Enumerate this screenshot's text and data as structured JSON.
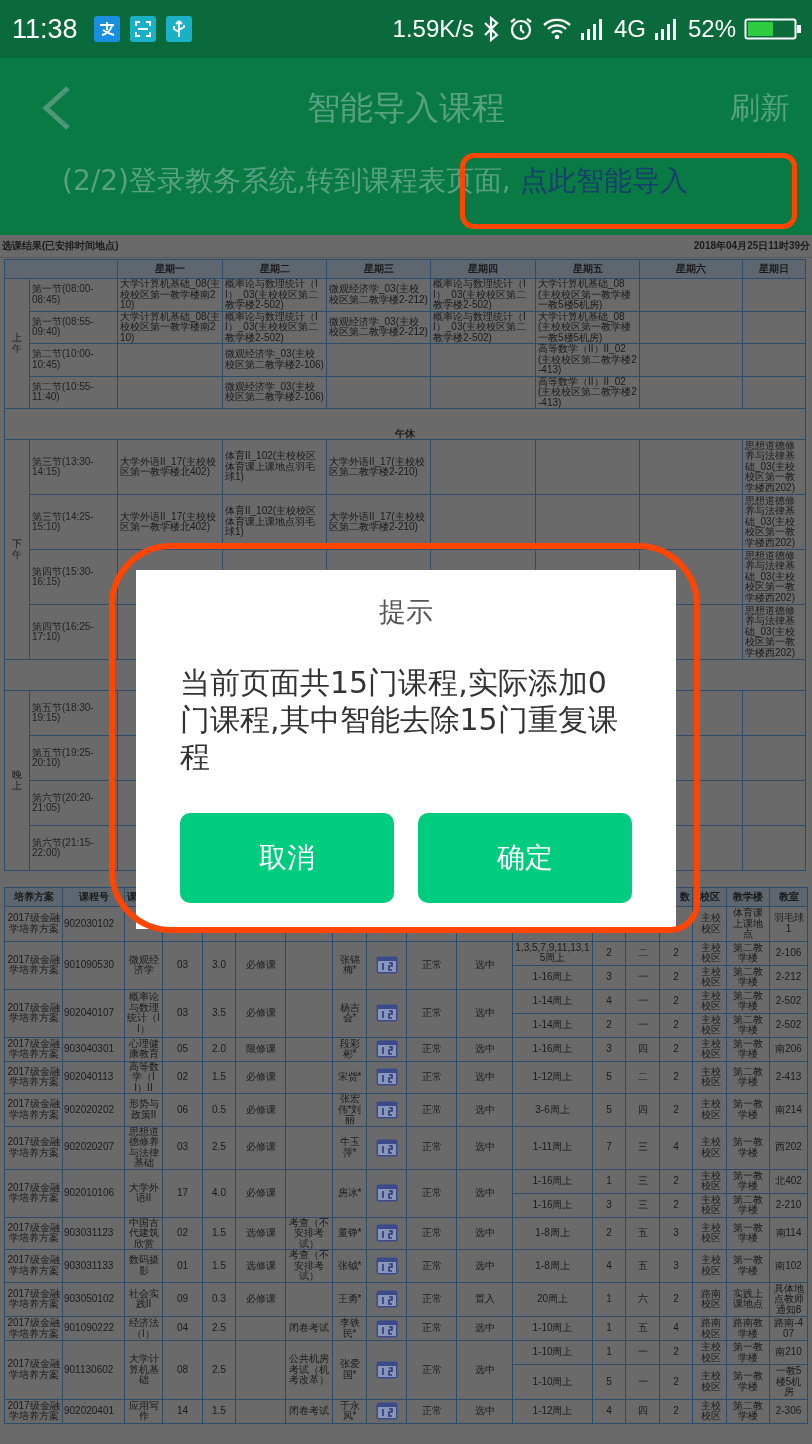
{
  "status_bar": {
    "time": "11:38",
    "speed": "1.59K/s",
    "network": "4G",
    "battery": "52%"
  },
  "app_bar": {
    "title": "智能导入课程",
    "action": "刷新",
    "instruction": "(2/2)登录教务系统,转到课程表页面, ",
    "link": "点此智能导入"
  },
  "timetable": {
    "caption": "选课结果(已安排时间地点)",
    "timestamp": "2018年04月25日11时39分",
    "days": [
      "星期一",
      "星期二",
      "星期三",
      "星期四",
      "星期五",
      "星期六",
      "星期日"
    ],
    "sections": [
      {
        "kind": "group",
        "label": "上午",
        "periods": [
          {
            "name": "第一节(08:00-08:45)",
            "cells": [
              "大学计算机基础_08(主校校区第一教学楼南210)",
              "概率论与数理统计（II）_03(主校校区第二教学楼2-502)",
              "微观经济学_03(主校校区第二教学楼2-212)",
              "概率论与数理统计（II）_03(主校校区第二教学楼2-502)",
              "大学计算机基础_08(主校校区第一教学楼一教5楼5机房)",
              null,
              null
            ]
          },
          {
            "name": "第一节(08:55-09:40)",
            "cells": [
              "大学计算机基础_08(主校校区第一教学楼南210)",
              "概率论与数理统计（II）_03(主校校区第二教学楼2-502)",
              "微观经济学_03(主校校区第二教学楼2-212)",
              "概率论与数理统计（II）_03(主校校区第二教学楼2-502)",
              "大学计算机基础_08(主校校区第一教学楼一教5楼5机房)",
              null,
              null
            ]
          },
          {
            "name": "第二节(10:00-10:45)",
            "cells": [
              null,
              "微观经济学_03(主校校区第二教学楼2-106)",
              null,
              null,
              "高等数学（II）II_02(主校校区第二教学楼2-413)",
              null,
              null
            ]
          },
          {
            "name": "第二节(10:55-11:40)",
            "cells": [
              null,
              "微观经济学_03(主校校区第二教学楼2-106)",
              null,
              null,
              "高等数学（II）II_02(主校校区第二教学楼2-413)",
              null,
              null
            ]
          }
        ]
      },
      {
        "kind": "break",
        "label": "午休"
      },
      {
        "kind": "group",
        "label": "下午",
        "periods": [
          {
            "name": "第三节(13:30-14:15)",
            "cells": [
              "大学外语II_17(主校校区第一教学楼北402)",
              "体育II_102(主校校区体育课上课地点羽毛球1)",
              "大学外语II_17(主校校区第二教学楼2-210)",
              null,
              null,
              null,
              "思想道德修养与法律基础_03(主校校区第一教学楼西202)"
            ]
          },
          {
            "name": "第三节(14:25-15:10)",
            "cells": [
              "大学外语II_17(主校校区第一教学楼北402)",
              "体育II_102(主校校区体育课上课地点羽毛球1)",
              "大学外语II_17(主校校区第二教学楼2-210)",
              null,
              null,
              null,
              "思想道德修养与法律基础_03(主校校区第一教学楼西202)"
            ]
          },
          {
            "name": "第四节(15:30-16:15)",
            "cells": [
              null,
              null,
              null,
              null,
              null,
              null,
              "思想道德修养与法律基础_03(主校校区第一教学楼西202)"
            ]
          },
          {
            "name": "第四节(16:25-17:10)",
            "cells": [
              null,
              null,
              null,
              null,
              null,
              null,
              "思想道德修养与法律基础_03(主校校区第一教学楼西202)"
            ]
          }
        ]
      },
      {
        "kind": "break"
      },
      {
        "kind": "group",
        "label": "晚上",
        "periods": [
          {
            "name": "第五节(18:30-19:15)",
            "cells": [
              null,
              null,
              null,
              null,
              null,
              null,
              null
            ]
          },
          {
            "name": "第五节(19:25-20:10)",
            "cells": [
              null,
              null,
              null,
              null,
              null,
              null,
              null
            ]
          },
          {
            "name": "第六节(20:20-21:05)",
            "cells": [
              null,
              null,
              null,
              null,
              null,
              null,
              null
            ]
          },
          {
            "name": "第六节(21:15-22:00)",
            "cells": [
              null,
              null,
              null,
              null,
              null,
              null,
              null
            ]
          }
        ]
      }
    ]
  },
  "course_table": {
    "columns": [
      "培养方案",
      "课程号",
      "课",
      null,
      null,
      null,
      null,
      null,
      null,
      null,
      null,
      null,
      null,
      null,
      "数",
      "校区",
      "教学楼",
      "教室"
    ],
    "rows": [
      {
        "plan": "2017级金融学培养方案",
        "code": "902030102",
        "sessions": [
          {
            "campus": "主校校区",
            "building": "体育课上课地点",
            "room": "羽毛球1"
          }
        ]
      },
      {
        "plan": "2017级金融学培养方案",
        "code": "901090530",
        "name": "微观经济学",
        "seq": "03",
        "credit": "3.0",
        "attr": "必修课",
        "teacher": "张锦梅*",
        "status": "正常",
        "pick": "选中",
        "sessions": [
          {
            "weeks": "1,3,5,7,9,11,13,15周上",
            "period": "2",
            "day": "二",
            "count": "2",
            "campus": "主校校区",
            "building": "第二教学楼",
            "room": "2-106"
          },
          {
            "weeks": "1-16周上",
            "period": "3",
            "day": "一",
            "count": "2",
            "campus": "主校校区",
            "building": "第二教学楼",
            "room": "2-212"
          }
        ]
      },
      {
        "plan": "2017级金融学培养方案",
        "code": "902040107",
        "name": "概率论与数理统计（II）",
        "seq": "03",
        "credit": "3.5",
        "attr": "必修课",
        "teacher": "杨吉会*",
        "status": "正常",
        "pick": "选中",
        "sessions": [
          {
            "weeks": "1-14周上",
            "period": "4",
            "day": "一",
            "count": "2",
            "campus": "主校校区",
            "building": "第二教学楼",
            "room": "2-502"
          },
          {
            "weeks": "1-14周上",
            "period": "2",
            "day": "一",
            "count": "2",
            "campus": "主校校区",
            "building": "第二教学楼",
            "room": "2-502"
          }
        ]
      },
      {
        "plan": "2017级金融学培养方案",
        "code": "903040301",
        "name": "心理健康教育",
        "seq": "05",
        "credit": "2.0",
        "attr": "限修课",
        "teacher": "段彩彬*",
        "status": "正常",
        "pick": "选中",
        "sessions": [
          {
            "weeks": "1-16周上",
            "period": "3",
            "day": "四",
            "count": "2",
            "campus": "主校校区",
            "building": "第一教学楼",
            "room": "南206"
          }
        ]
      },
      {
        "plan": "2017级金融学培养方案",
        "code": "902040113",
        "name": "高等数学（II）II",
        "seq": "02",
        "credit": "1.5",
        "attr": "必修课",
        "teacher": "宋赀*",
        "status": "正常",
        "pick": "选中",
        "sessions": [
          {
            "weeks": "1-12周上",
            "period": "5",
            "day": "二",
            "count": "2",
            "campus": "主校校区",
            "building": "第二教学楼",
            "room": "2-413"
          }
        ]
      },
      {
        "plan": "2017级金融学培养方案",
        "code": "902020202",
        "name": "形势与政策II",
        "seq": "06",
        "credit": "0.5",
        "attr": "必修课",
        "teacher": "张宏伟*刘丽",
        "status": "正常",
        "pick": "选中",
        "sessions": [
          {
            "weeks": "3-6周上",
            "period": "5",
            "day": "四",
            "count": "2",
            "campus": "主校校区",
            "building": "第一教学楼",
            "room": "南214"
          }
        ]
      },
      {
        "plan": "2017级金融学培养方案",
        "code": "902020207",
        "name": "思想道德修养与法律基础",
        "seq": "03",
        "credit": "2.5",
        "attr": "必修课",
        "teacher": "牛玉萍*",
        "status": "正常",
        "pick": "选中",
        "sessions": [
          {
            "weeks": "1-11周上",
            "period": "7",
            "day": "三",
            "count": "4",
            "campus": "主校校区",
            "building": "第一教学楼",
            "room": "西202"
          }
        ]
      },
      {
        "plan": "2017级金融学培养方案",
        "code": "902010106",
        "name": "大学外语II",
        "seq": "17",
        "credit": "4.0",
        "attr": "必修课",
        "teacher": "房冰*",
        "status": "正常",
        "pick": "选中",
        "sessions": [
          {
            "weeks": "1-16周上",
            "period": "1",
            "day": "三",
            "count": "2",
            "campus": "主校校区",
            "building": "第一教学楼",
            "room": "北402"
          },
          {
            "weeks": "1-16周上",
            "period": "3",
            "day": "三",
            "count": "2",
            "campus": "主校校区",
            "building": "第二教学楼",
            "room": "2-210"
          }
        ]
      },
      {
        "plan": "2017级金融学培养方案",
        "code": "903031123",
        "name": "中国古代建筑欣赏",
        "seq": "02",
        "credit": "1.5",
        "attr": "选修课",
        "exam": "考查（不安排考试）",
        "teacher": "董铮*",
        "status": "正常",
        "pick": "选中",
        "sessions": [
          {
            "weeks": "1-8周上",
            "period": "2",
            "day": "五",
            "count": "3",
            "campus": "主校校区",
            "building": "第一教学楼",
            "room": "南114"
          }
        ]
      },
      {
        "plan": "2017级金融学培养方案",
        "code": "903031133",
        "name": "数码摄影",
        "seq": "01",
        "credit": "1.5",
        "attr": "选修课",
        "exam": "考查（不安排考试）",
        "teacher": "张钺*",
        "status": "正常",
        "pick": "选中",
        "sessions": [
          {
            "weeks": "1-8周上",
            "period": "4",
            "day": "五",
            "count": "3",
            "campus": "主校校区",
            "building": "第一教学楼",
            "room": "南102"
          }
        ]
      },
      {
        "plan": "2017级金融学培养方案",
        "code": "903050102",
        "name": "社会实践II",
        "seq": "09",
        "credit": "0.3",
        "attr": "必修课",
        "teacher": "王勇*",
        "status": "正常",
        "pick": "置入",
        "sessions": [
          {
            "weeks": "20周上",
            "period": "1",
            "day": "六",
            "count": "2",
            "campus": "路南校区",
            "building": "实践上课地点",
            "room": "具体地点教师通知8"
          }
        ]
      },
      {
        "plan": "2017级金融学培养方案",
        "code": "901090222",
        "name": "经济法（I）",
        "seq": "04",
        "credit": "2.5",
        "exam": "闭卷考试",
        "teacher": "李铁民*",
        "status": "正常",
        "pick": "选中",
        "sessions": [
          {
            "weeks": "1-10周上",
            "period": "1",
            "day": "五",
            "count": "4",
            "campus": "路南校区",
            "building": "路南教学楼",
            "room": "路南-407"
          }
        ]
      },
      {
        "plan": "2017级金融学培养方案",
        "code": "901130602",
        "name": "大学计算机基础",
        "seq": "08",
        "credit": "2.5",
        "exam": "公共机房考试（机考改革）",
        "teacher": "张爱国*",
        "status": "正常",
        "pick": "选中",
        "sessions": [
          {
            "weeks": "1-10周上",
            "period": "1",
            "day": "一",
            "count": "2",
            "campus": "主校校区",
            "building": "第一教学楼",
            "room": "南210"
          },
          {
            "weeks": "1-10周上",
            "period": "5",
            "day": "一",
            "count": "2",
            "campus": "主校校区",
            "building": "第一教学楼",
            "room": "一教5楼5机房"
          }
        ]
      },
      {
        "plan": "2017级金融学培养方案",
        "code": "902020401",
        "name": "应用写作",
        "seq": "14",
        "credit": "1.5",
        "exam": "闭卷考试",
        "teacher": "于永凤*",
        "status": "正常",
        "pick": "选中",
        "sessions": [
          {
            "weeks": "1-12周上",
            "period": "4",
            "day": "四",
            "count": "2",
            "campus": "主校校区",
            "building": "第二教学楼",
            "room": "2-306"
          }
        ]
      }
    ]
  },
  "dialog": {
    "title": "提示",
    "message": "当前页面共15门课程,实际添加0门课程,其中智能去除15门重复课程",
    "buttons": [
      "取消",
      "确定"
    ]
  }
}
